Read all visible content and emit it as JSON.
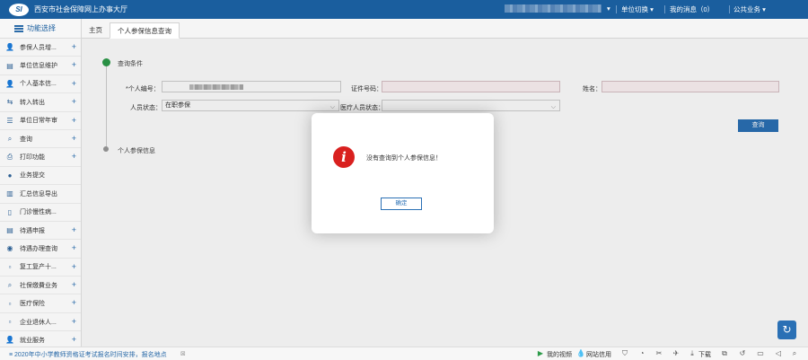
{
  "header": {
    "logo_text": "SI",
    "title": "西安市社会保障网上办事大厅",
    "unit_switch": "单位切换",
    "messages": "我的消息",
    "message_count": "0",
    "public_service": "公共业务"
  },
  "sidebar": {
    "title": "功能选择",
    "items": [
      {
        "label": "参保人员增...",
        "icon": "person-add-icon",
        "icon_glyph": "👤",
        "has_plus": true
      },
      {
        "label": "单位信息维护",
        "icon": "unit-edit-icon",
        "icon_glyph": "▤",
        "has_plus": true
      },
      {
        "label": "个人基本信...",
        "icon": "person-info-icon",
        "icon_glyph": "👤",
        "has_plus": true
      },
      {
        "label": "转入转出",
        "icon": "transfer-icon",
        "icon_glyph": "⇆",
        "has_plus": true
      },
      {
        "label": "单位日常年审",
        "icon": "list-icon",
        "icon_glyph": "☰",
        "has_plus": true
      },
      {
        "label": "查询",
        "icon": "search-icon",
        "icon_glyph": "⌕",
        "has_plus": true
      },
      {
        "label": "打印功能",
        "icon": "print-icon",
        "icon_glyph": "⎙",
        "has_plus": true
      },
      {
        "label": "业务提交",
        "icon": "submit-icon",
        "icon_glyph": "●",
        "has_plus": false
      },
      {
        "label": "汇总信息导出",
        "icon": "export-icon",
        "icon_glyph": "▥",
        "has_plus": false
      },
      {
        "label": "门诊慢性病...",
        "icon": "clinic-icon",
        "icon_glyph": "▯",
        "has_plus": false
      },
      {
        "label": "待遇申报",
        "icon": "report-icon",
        "icon_glyph": "▤",
        "has_plus": true
      },
      {
        "label": "待遇办理查询",
        "icon": "query-icon",
        "icon_glyph": "◉",
        "has_plus": true
      },
      {
        "label": "复工复产十...",
        "icon": "broken-image-icon",
        "icon_glyph": "▫",
        "has_plus": true
      },
      {
        "label": "社保缴費业务",
        "icon": "payment-search-icon",
        "icon_glyph": "⌕",
        "has_plus": true
      },
      {
        "label": "医疗保险",
        "icon": "broken-image-icon",
        "icon_glyph": "▫",
        "has_plus": true
      },
      {
        "label": "企业退休人...",
        "icon": "broken-image-icon",
        "icon_glyph": "▫",
        "has_plus": true
      },
      {
        "label": "就业服务",
        "icon": "employment-icon",
        "icon_glyph": "👤",
        "has_plus": true
      }
    ]
  },
  "tabs": [
    {
      "label": "主页",
      "active": false
    },
    {
      "label": "个人参保信息查询",
      "active": true
    }
  ],
  "form": {
    "section_query": "查询条件",
    "section_info": "个人参保信息",
    "person_no_label": "*个人编号：",
    "id_no_label": "证件号码：",
    "name_label": "姓名：",
    "status_label": "人员状态：",
    "status_value": "在职参保",
    "medical_status_label": "医疗人员状态：",
    "medical_status_value": "",
    "query_button": "查询"
  },
  "dialog": {
    "icon_glyph": "i",
    "message": "没有查询到个人参保信息！",
    "ok_button": "确定"
  },
  "statusbar": {
    "news": "2020年中小学教师资格证考试报名时间安排，报名地点",
    "my_video": "我的视频",
    "site_credit": "网站信用",
    "download": "下载"
  },
  "colors": {
    "header_bg": "#1a5e9e",
    "primary_button": "#2a70b5",
    "alert_red": "#d9201f",
    "active_step": "#2d9b4a"
  }
}
